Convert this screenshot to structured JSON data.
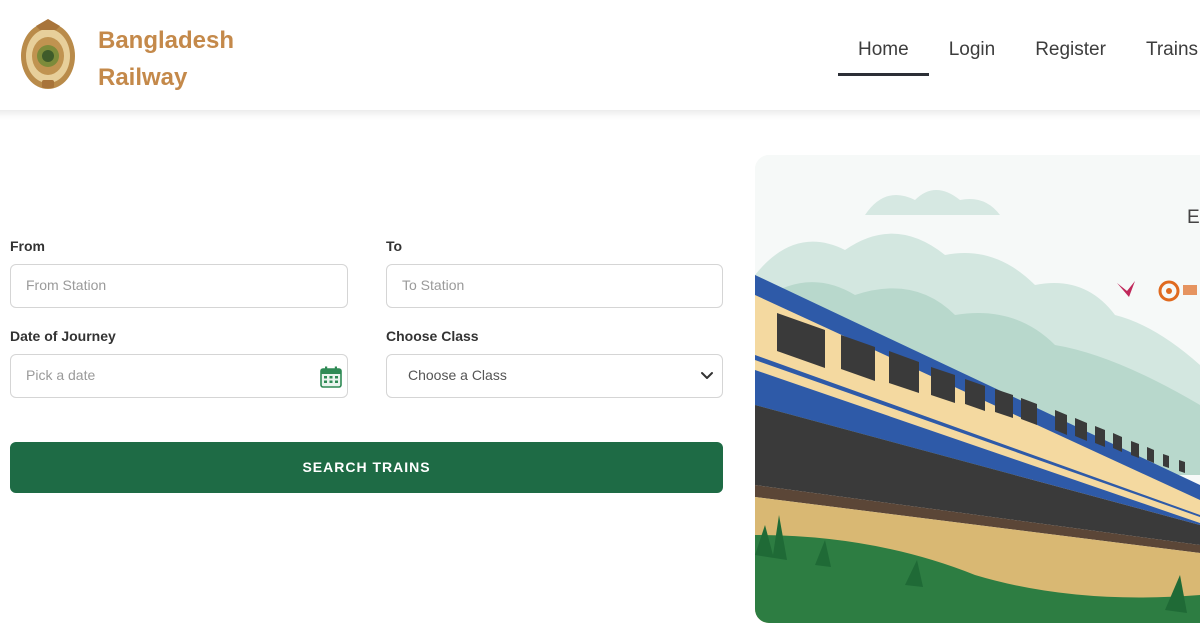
{
  "brand": {
    "line1": "Bangladesh",
    "line2": "Railway"
  },
  "nav": {
    "items": [
      {
        "label": "Home",
        "active": true
      },
      {
        "label": "Login",
        "active": false
      },
      {
        "label": "Register",
        "active": false
      },
      {
        "label": "Trains",
        "active": false
      }
    ]
  },
  "form": {
    "from": {
      "label": "From",
      "placeholder": "From Station"
    },
    "to": {
      "label": "To",
      "placeholder": "To Station"
    },
    "date": {
      "label": "Date of Journey",
      "placeholder": "Pick a date",
      "icon": "calendar-icon"
    },
    "class": {
      "label": "Choose Class",
      "selected": "Choose a Class",
      "icon": "chevron-down-icon"
    },
    "search_label": "SEARCH TRAINS"
  },
  "banner": {
    "partial_text": "Ea"
  },
  "colors": {
    "brand_text": "#c4894a",
    "primary_button": "#1e6b45",
    "train_blue": "#2e5aa8",
    "train_cream": "#f4d9a0",
    "grass": "#2d7d42"
  }
}
